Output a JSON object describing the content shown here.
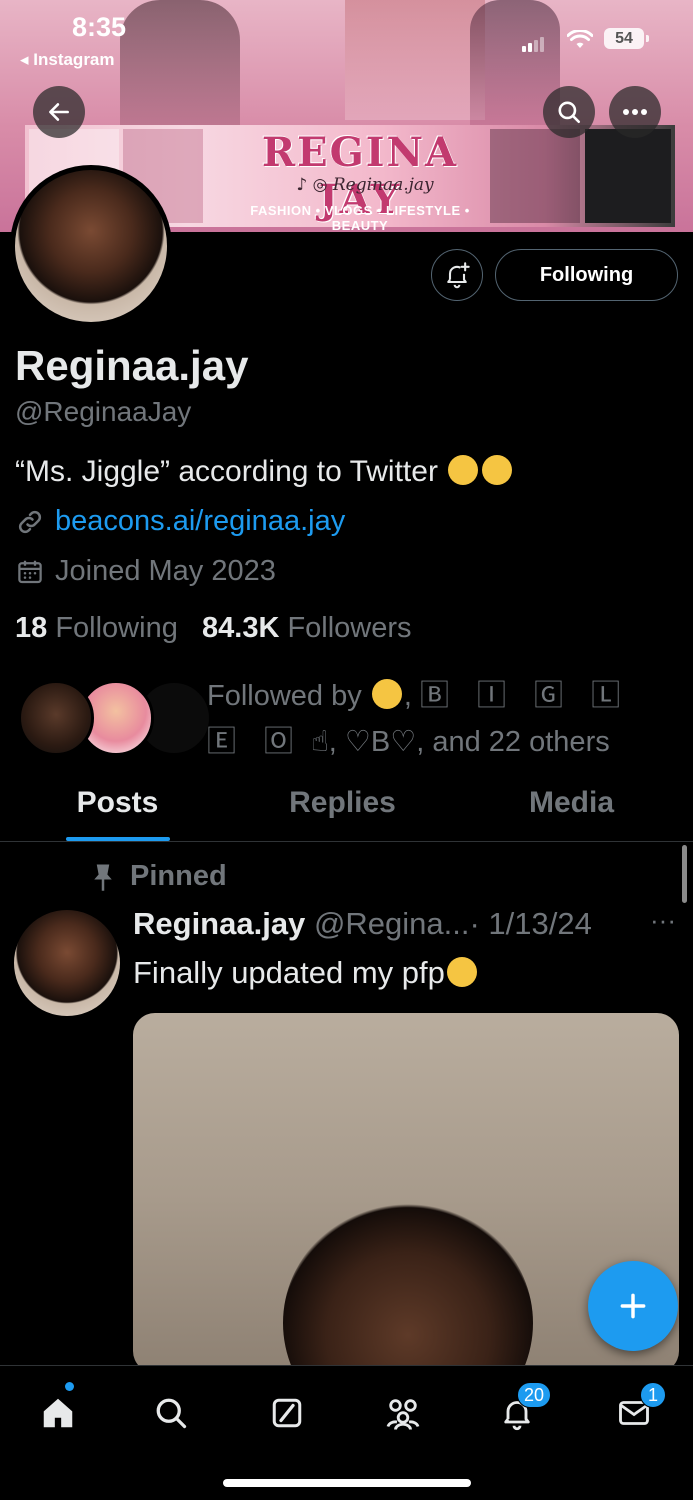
{
  "status_bar": {
    "time": "8:35",
    "back_app": "◂ Instagram",
    "battery": "54"
  },
  "banner": {
    "brand_title": "REGINA JAY",
    "brand_social": "♪ ◎ Reginaa.jay",
    "brand_tagline": "FASHION • VLOGS • LIFESTYLE • BEAUTY"
  },
  "actions": {
    "follow_label": "Following"
  },
  "profile": {
    "display_name": "Reginaa.jay",
    "handle": "@ReginaaJay",
    "bio": "“Ms. Jiggle” according to Twitter",
    "link": "beacons.ai/reginaa.jay",
    "joined": "Joined May 2023",
    "following_count": "18",
    "following_label": "Following",
    "followers_count": "84.3K",
    "followers_label": "Followers",
    "followed_by_prefix": "Followed by",
    "followed_by_names": "🄱 🄸 🄶 🄻 🄴 🄾",
    "followed_by_suffix": ", ♡B♡, and 22 others"
  },
  "tabs": [
    {
      "label": "Posts",
      "active": true
    },
    {
      "label": "Replies",
      "active": false
    },
    {
      "label": "Media",
      "active": false
    }
  ],
  "pinned_post": {
    "pinned_label": "Pinned",
    "author_name": "Reginaa.jay",
    "author_handle": "@Regina...",
    "date": "· 1/13/24",
    "more": "···",
    "text": "Finally updated my pfp"
  },
  "bottom_nav": {
    "notifications_badge": "20",
    "messages_badge": "1"
  },
  "colors": {
    "accent": "#1d9bf0",
    "background": "#000000",
    "muted": "#71767b",
    "text": "#e7e9ea"
  }
}
